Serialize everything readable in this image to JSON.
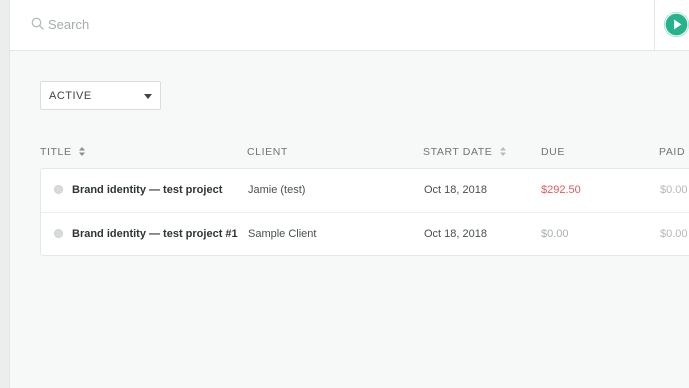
{
  "search": {
    "placeholder": "Search"
  },
  "filter": {
    "selected": "ACTIVE"
  },
  "columns": {
    "title": "TITLE",
    "client": "CLIENT",
    "start_date": "START DATE",
    "due": "DUE",
    "paid": "PAID"
  },
  "rows": [
    {
      "title": "Brand identity — test project",
      "client": "Jamie (test)",
      "start_date": "Oct 18, 2018",
      "due": "$292.50",
      "paid": "$0.00"
    },
    {
      "title": "Brand identity — test project #1",
      "client": "Sample Client",
      "start_date": "Oct 18, 2018",
      "due": "$0.00",
      "paid": "$0.00"
    }
  ],
  "colors": {
    "accent": "#26b38b",
    "overdue": "#e05a5a"
  },
  "icons": {
    "search": "search-icon",
    "play": "play-icon",
    "chevron": "chevron-down-icon",
    "sort": "sort-icon"
  }
}
